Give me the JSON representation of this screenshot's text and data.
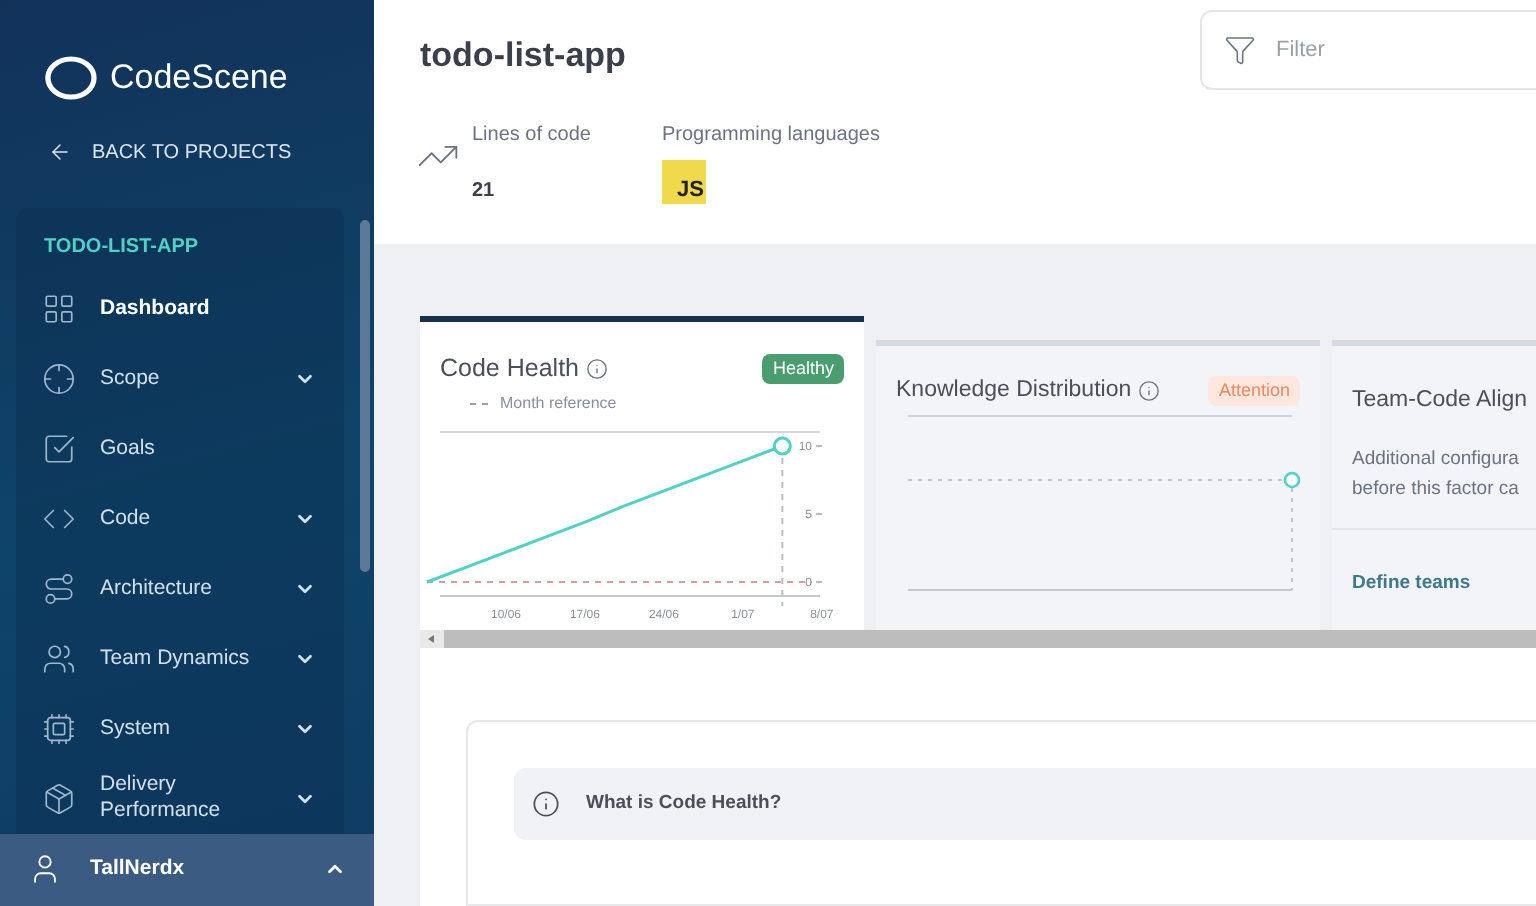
{
  "sidebar": {
    "logo": "CodeScene",
    "back_link": "BACK TO PROJECTS",
    "project": "TODO-LIST-APP",
    "items": [
      {
        "label": "Dashboard",
        "selected": true
      },
      {
        "label": "Scope",
        "selected": false,
        "expanded": false
      },
      {
        "label": "Goals",
        "selected": false
      },
      {
        "label": "Code",
        "selected": false,
        "expanded": false
      },
      {
        "label": "Architecture",
        "selected": false,
        "expanded": false
      },
      {
        "label": "Team Dynamics",
        "selected": false,
        "expanded": false
      },
      {
        "label": "System",
        "selected": false,
        "expanded": false
      },
      {
        "label": "Delivery Performance",
        "selected": false,
        "expanded": false
      }
    ],
    "user": {
      "name": "TallNerdx",
      "expanded": true
    }
  },
  "header": {
    "title": "todo-list-app",
    "filter": {
      "placeholder": "Filter"
    },
    "stats": [
      {
        "label": "Lines of code",
        "value": "21"
      },
      {
        "label": "Programming languages",
        "badge": "JS"
      }
    ]
  },
  "cards": [
    {
      "kind": "chart",
      "title": "Code Health",
      "status": {
        "kind": "healthy",
        "label": "Healthy"
      },
      "legend": "Month reference",
      "chart_data": {
        "type": "line",
        "categories": [
          null,
          null,
          "10/06",
          null,
          "17/06",
          null,
          "24/06",
          null,
          "1/07",
          null,
          "8/07"
        ],
        "series": [
          {
            "color": "#4fd1c5",
            "values": [
              0,
              1.1,
              2.2,
              3.3,
              4.4,
              5.6,
              6.7,
              7.8,
              8.9,
              10,
              null
            ]
          }
        ],
        "yticks": [
          0,
          5,
          10
        ],
        "ylim": [
          0,
          10
        ]
      }
    },
    {
      "kind": "sparkline",
      "title": "Knowledge Distribution",
      "status": {
        "kind": "attention",
        "label": "Attention"
      }
    },
    {
      "kind": "config",
      "title": "Team-Code Align",
      "description": [
        "Additional configura",
        "before this factor ca"
      ],
      "link": "Define teams"
    }
  ],
  "info": {
    "title": "What is Code Health?"
  }
}
